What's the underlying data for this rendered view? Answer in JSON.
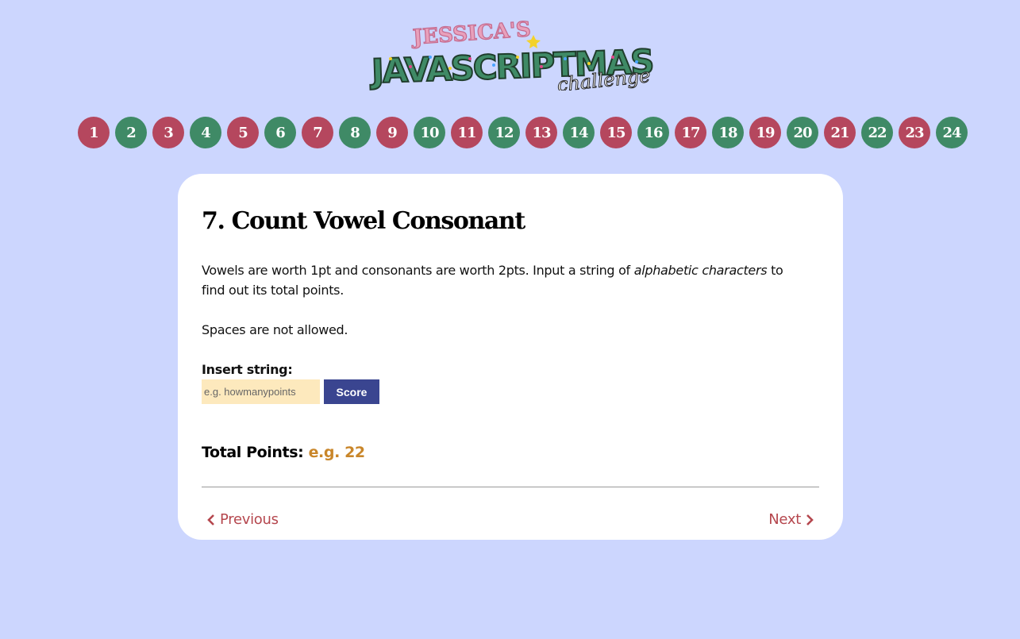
{
  "logo": {
    "top_text": "JESSICA'S",
    "main_text": "JAVASCRIPTMAS",
    "sub_text": "challenge"
  },
  "days": [
    {
      "label": "1",
      "color": "red"
    },
    {
      "label": "2",
      "color": "green"
    },
    {
      "label": "3",
      "color": "red"
    },
    {
      "label": "4",
      "color": "green"
    },
    {
      "label": "5",
      "color": "red"
    },
    {
      "label": "6",
      "color": "green"
    },
    {
      "label": "7",
      "color": "red"
    },
    {
      "label": "8",
      "color": "green"
    },
    {
      "label": "9",
      "color": "red"
    },
    {
      "label": "10",
      "color": "green"
    },
    {
      "label": "11",
      "color": "red"
    },
    {
      "label": "12",
      "color": "green"
    },
    {
      "label": "13",
      "color": "red"
    },
    {
      "label": "14",
      "color": "green"
    },
    {
      "label": "15",
      "color": "red"
    },
    {
      "label": "16",
      "color": "green"
    },
    {
      "label": "17",
      "color": "red"
    },
    {
      "label": "18",
      "color": "green"
    },
    {
      "label": "19",
      "color": "red"
    },
    {
      "label": "20",
      "color": "green"
    },
    {
      "label": "21",
      "color": "red"
    },
    {
      "label": "22",
      "color": "green"
    },
    {
      "label": "23",
      "color": "red"
    },
    {
      "label": "24",
      "color": "green"
    }
  ],
  "challenge": {
    "title": "7. Count Vowel Consonant",
    "desc_before": "Vowels are worth 1pt and consonants are worth 2pts. Input a string of ",
    "desc_emphasis": "alphabetic characters",
    "desc_after": " to find out its total points.",
    "note": "Spaces are not allowed.",
    "input_label": "Insert string:",
    "input_placeholder": "e.g. howmanypoints",
    "input_value": "",
    "button_label": "Score",
    "total_label": "Total Points:",
    "total_value": "e.g. 22"
  },
  "navigation": {
    "previous_label": "Previous",
    "next_label": "Next"
  },
  "colors": {
    "background": "#ccd6fe",
    "day_red": "#b5475e",
    "day_green": "#3f8a66",
    "button": "#3a4590",
    "input_bg": "#fde9bd",
    "total_value": "#c9862a",
    "nav_link": "#b5474e"
  }
}
